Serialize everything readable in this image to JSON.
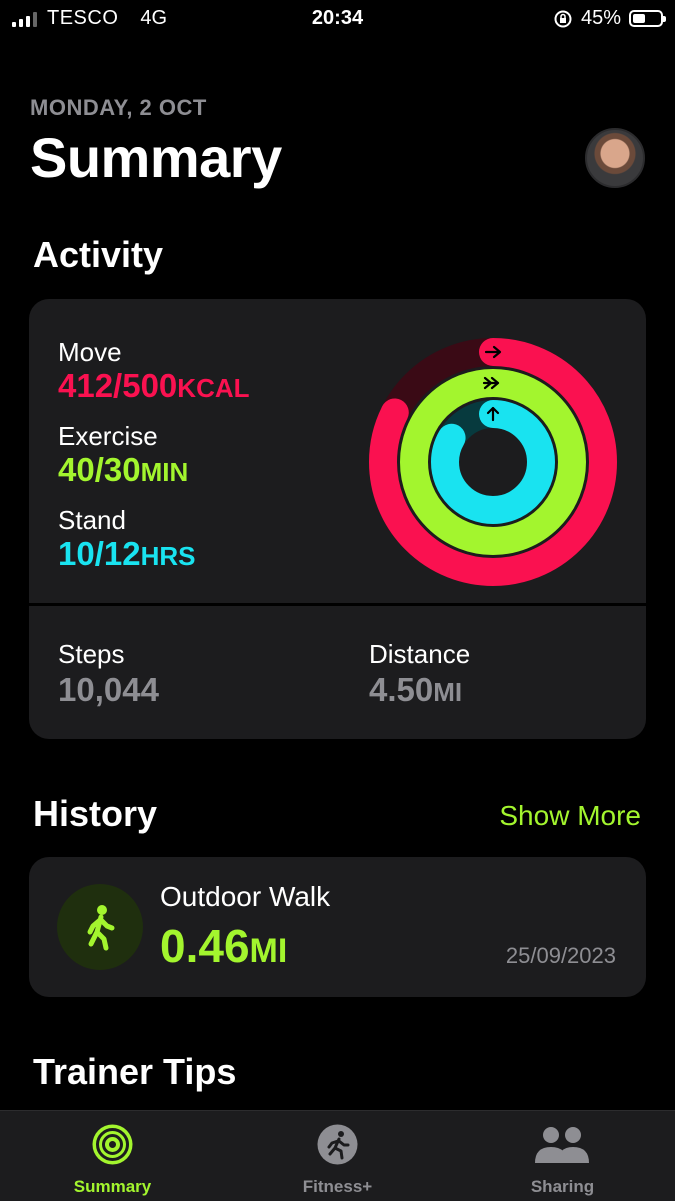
{
  "status_bar": {
    "carrier": "TESCO",
    "network": "4G",
    "time": "20:34",
    "battery": "45%",
    "battery_level": 0.45
  },
  "header": {
    "date": "MONDAY, 2 OCT",
    "title": "Summary"
  },
  "activity": {
    "title": "Activity",
    "move": {
      "label": "Move",
      "value": "412/500",
      "unit": "KCAL",
      "color": "#fa1150",
      "progress": 0.824
    },
    "exercise": {
      "label": "Exercise",
      "value": "40/30",
      "unit": "MIN",
      "color": "#a3f52e",
      "progress": 1.333
    },
    "stand": {
      "label": "Stand",
      "value": "10/12",
      "unit": "HRS",
      "color": "#19e3f0",
      "progress": 0.833
    },
    "steps": {
      "label": "Steps",
      "value": "10,044"
    },
    "distance": {
      "label": "Distance",
      "value": "4.50",
      "unit": "MI"
    }
  },
  "history": {
    "title": "History",
    "show_more": "Show More",
    "item": {
      "name": "Outdoor Walk",
      "distance": "0.46",
      "unit": "MI",
      "date": "25/09/2023",
      "icon": "walking-figure-icon"
    }
  },
  "trainer_tips": {
    "title": "Trainer Tips"
  },
  "tab_bar": {
    "tabs": [
      {
        "label": "Summary",
        "icon": "activity-rings-icon",
        "active": true
      },
      {
        "label": "Fitness+",
        "icon": "fitness-runner-icon",
        "active": false
      },
      {
        "label": "Sharing",
        "icon": "people-icon",
        "active": false
      }
    ]
  },
  "colors": {
    "accent": "#a3f52e",
    "background": "#000000",
    "card": "#1c1c1e"
  }
}
